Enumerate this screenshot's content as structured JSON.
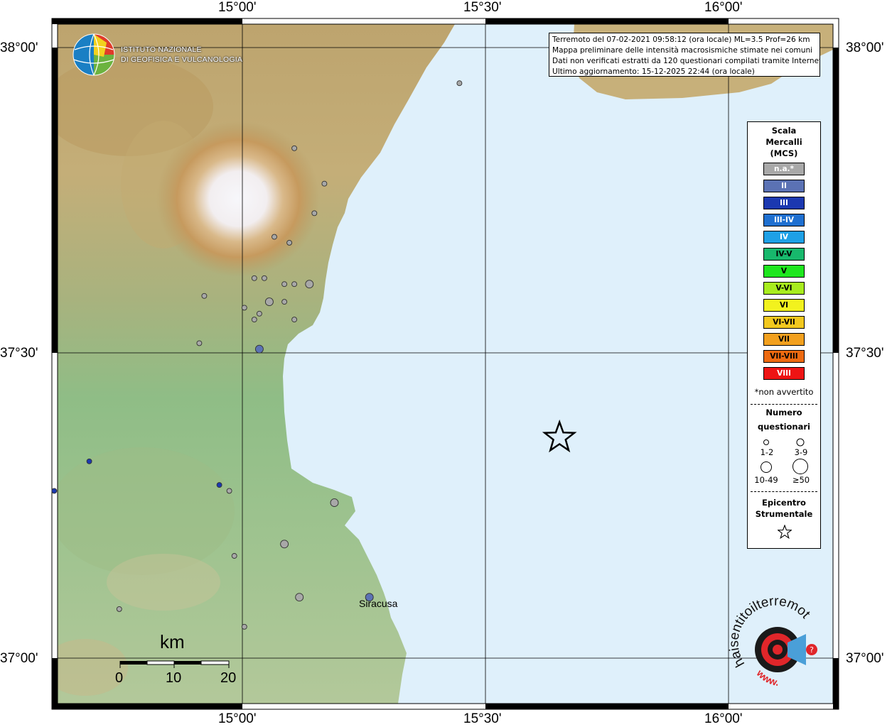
{
  "agency": {
    "name_line1": "ISTITUTO NAZIONALE",
    "name_line2": "DI GEOFISICA E VULCANOLOGIA"
  },
  "info": {
    "line1": "Terremoto del 07-02-2021 09:58:12 (ora locale) ML=3.5 Prof=26 km",
    "line2": "Mappa preliminare delle intensità macrosismiche stimate nei comuni",
    "line3": "Dati non verificati estratti da 120 questionari compilati tramite Internet.",
    "line4": "Ultimo aggiornamento: 15-12-2025 22:44 (ora locale)"
  },
  "axes": {
    "lon_labels": [
      "15°00'",
      "15°30'",
      "16°00'"
    ],
    "lat_labels": [
      "38°00'",
      "37°30'",
      "37°00'"
    ]
  },
  "legend": {
    "title_line1": "Scala",
    "title_line2": "Mercalli",
    "title_line3": "(MCS)",
    "classes": [
      {
        "label": "n.a.*",
        "color": "#a8a8a8",
        "text_color": "#ffffff"
      },
      {
        "label": "II",
        "color": "#5b72b4",
        "text_color": "#ffffff"
      },
      {
        "label": "III",
        "color": "#1b38b0",
        "text_color": "#ffffff"
      },
      {
        "label": "III-IV",
        "color": "#1e6fd0",
        "text_color": "#ffffff"
      },
      {
        "label": "IV",
        "color": "#1ea0e6",
        "text_color": "#ffffff"
      },
      {
        "label": "IV-V",
        "color": "#17b86c",
        "text_color": "#000000"
      },
      {
        "label": "V",
        "color": "#1ee61e",
        "text_color": "#000000"
      },
      {
        "label": "V-VI",
        "color": "#a8ec1e",
        "text_color": "#000000"
      },
      {
        "label": "VI",
        "color": "#f2f21e",
        "text_color": "#000000"
      },
      {
        "label": "VI-VII",
        "color": "#f2c81e",
        "text_color": "#000000"
      },
      {
        "label": "VII",
        "color": "#f2a01e",
        "text_color": "#000000"
      },
      {
        "label": "VII-VIII",
        "color": "#ee6a10",
        "text_color": "#000000"
      },
      {
        "label": "VIII",
        "color": "#ee1414",
        "text_color": "#ffffff"
      }
    ],
    "not_felt_note": "*non avvertito",
    "count_title_line1": "Numero",
    "count_title_line2": "questionari",
    "count_labels": [
      "1-2",
      "3-9",
      "10-49",
      "≥50"
    ],
    "epicenter_line1": "Epicentro",
    "epicenter_line2": "Strumentale"
  },
  "places": {
    "siracusa": "Siracusa"
  },
  "scalebar": {
    "unit": "km",
    "labels": [
      "0",
      "10",
      "20"
    ]
  },
  "badge": {
    "text": "haisentitoilterremoto.it",
    "url_text": "www."
  },
  "map": {
    "lon_range": [
      14.6667,
      16.2167
    ],
    "lat_range": [
      36.9,
      38.05
    ],
    "epicenter": {
      "lon": 15.67,
      "lat": 37.35
    },
    "points": [
      {
        "lon": 15.14,
        "lat": 37.84,
        "mcs": "n.a.*",
        "n": "1-2"
      },
      {
        "lon": 15.2,
        "lat": 37.78,
        "mcs": "n.a.*",
        "n": "1-2"
      },
      {
        "lon": 15.18,
        "lat": 37.73,
        "mcs": "n.a.*",
        "n": "1-2"
      },
      {
        "lon": 15.1,
        "lat": 37.69,
        "mcs": "n.a.*",
        "n": "1-2"
      },
      {
        "lon": 15.13,
        "lat": 37.68,
        "mcs": "n.a.*",
        "n": "1-2"
      },
      {
        "lon": 15.06,
        "lat": 37.62,
        "mcs": "n.a.*",
        "n": "1-2"
      },
      {
        "lon": 15.08,
        "lat": 37.62,
        "mcs": "n.a.*",
        "n": "1-2"
      },
      {
        "lon": 15.12,
        "lat": 37.61,
        "mcs": "n.a.*",
        "n": "1-2"
      },
      {
        "lon": 15.14,
        "lat": 37.61,
        "mcs": "n.a.*",
        "n": "1-2"
      },
      {
        "lon": 15.17,
        "lat": 37.61,
        "mcs": "n.a.*",
        "n": "3-9"
      },
      {
        "lon": 14.96,
        "lat": 37.59,
        "mcs": "n.a.*",
        "n": "1-2"
      },
      {
        "lon": 15.04,
        "lat": 37.57,
        "mcs": "n.a.*",
        "n": "1-2"
      },
      {
        "lon": 15.09,
        "lat": 37.58,
        "mcs": "n.a.*",
        "n": "3-9"
      },
      {
        "lon": 15.12,
        "lat": 37.58,
        "mcs": "n.a.*",
        "n": "1-2"
      },
      {
        "lon": 15.07,
        "lat": 37.56,
        "mcs": "n.a.*",
        "n": "1-2"
      },
      {
        "lon": 15.06,
        "lat": 37.55,
        "mcs": "n.a.*",
        "n": "1-2"
      },
      {
        "lon": 15.14,
        "lat": 37.55,
        "mcs": "n.a.*",
        "n": "1-2"
      },
      {
        "lon": 14.95,
        "lat": 37.51,
        "mcs": "n.a.*",
        "n": "1-2"
      },
      {
        "lon": 15.07,
        "lat": 37.5,
        "mcs": "II",
        "n": "3-9"
      },
      {
        "lon": 14.73,
        "lat": 37.31,
        "mcs": "III",
        "n": "1-2"
      },
      {
        "lon": 14.66,
        "lat": 37.26,
        "mcs": "III",
        "n": "1-2"
      },
      {
        "lon": 14.99,
        "lat": 37.27,
        "mcs": "III",
        "n": "1-2"
      },
      {
        "lon": 15.01,
        "lat": 37.26,
        "mcs": "n.a.*",
        "n": "1-2"
      },
      {
        "lon": 15.22,
        "lat": 37.24,
        "mcs": "n.a.*",
        "n": "3-9"
      },
      {
        "lon": 15.12,
        "lat": 37.17,
        "mcs": "n.a.*",
        "n": "3-9"
      },
      {
        "lon": 15.02,
        "lat": 37.15,
        "mcs": "n.a.*",
        "n": "1-2"
      },
      {
        "lon": 15.15,
        "lat": 37.08,
        "mcs": "n.a.*",
        "n": "3-9"
      },
      {
        "lon": 15.29,
        "lat": 37.08,
        "mcs": "II",
        "n": "3-9"
      },
      {
        "lon": 14.79,
        "lat": 37.06,
        "mcs": "n.a.*",
        "n": "1-2"
      },
      {
        "lon": 15.04,
        "lat": 37.03,
        "mcs": "n.a.*",
        "n": "1-2"
      },
      {
        "lon": 15.47,
        "lat": 37.95,
        "mcs": "n.a.*",
        "n": "1-2"
      }
    ]
  }
}
